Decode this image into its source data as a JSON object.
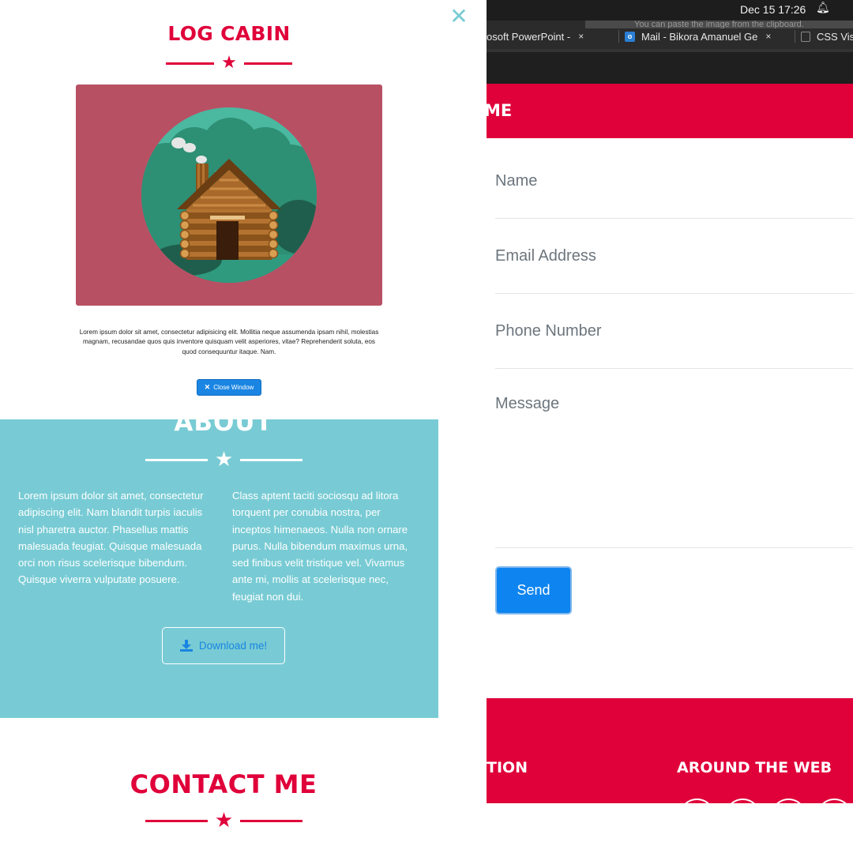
{
  "modal": {
    "close_glyph": "✕",
    "title": "LOG CABIN",
    "description": "Lorem ipsum dolor sit amet, consectetur adipisicing elit. Mollitia neque assumenda ipsam nihil, molestias magnam, recusandae quos quis inventore quisquam velit asperiores, vitae? Reprehenderit soluta, eos quod consequuntur itaque. Nam.",
    "close_button": {
      "icon": "✕",
      "label": "Close Window"
    },
    "image_bg_color": "#b85064"
  },
  "about": {
    "title": "ABOUT",
    "col1": "Lorem ipsum dolor sit amet, consectetur adipiscing elit. Nam blandit turpis iaculis nisl pharetra auctor. Phasellus mattis malesuada feugiat. Quisque malesuada orci non risus scelerisque bibendum. Quisque viverra vulputate posuere.",
    "col2": "Class aptent taciti sociosqu ad litora torquent per conubia nostra, per inceptos himenaeos. Nulla non ornare purus. Nulla bibendum maximus urna, sed finibus velit tristique vel. Vivamus ante mi, mollis at scelerisque nec, feugiat non dui.",
    "download_label": "Download me!",
    "bg_color": "#78cbd4"
  },
  "contact": {
    "title": "CONTACT ME"
  },
  "system": {
    "clock": "Dec 15  17:26",
    "bell_icon": "alarm-bell-icon",
    "tooltip": "You can paste the image from the clipboard."
  },
  "browser": {
    "tabs": [
      {
        "label": "osoft PowerPoint - ",
        "close": "×"
      },
      {
        "icon": "o",
        "label": "Mail - Bikora Amanuel Ge",
        "close": "×"
      },
      {
        "label": "CSS Vis"
      }
    ]
  },
  "form": {
    "header_title": "ME",
    "fields": [
      "Name",
      "Email Address",
      "Phone Number",
      "Message"
    ],
    "send_label": "Send"
  },
  "footer": {
    "heading_1": "TION",
    "heading_2": "AROUND THE WEB"
  },
  "colors": {
    "accent_red": "#e0003a",
    "teal": "#78cbd4",
    "button_blue": "#1a85e2"
  }
}
